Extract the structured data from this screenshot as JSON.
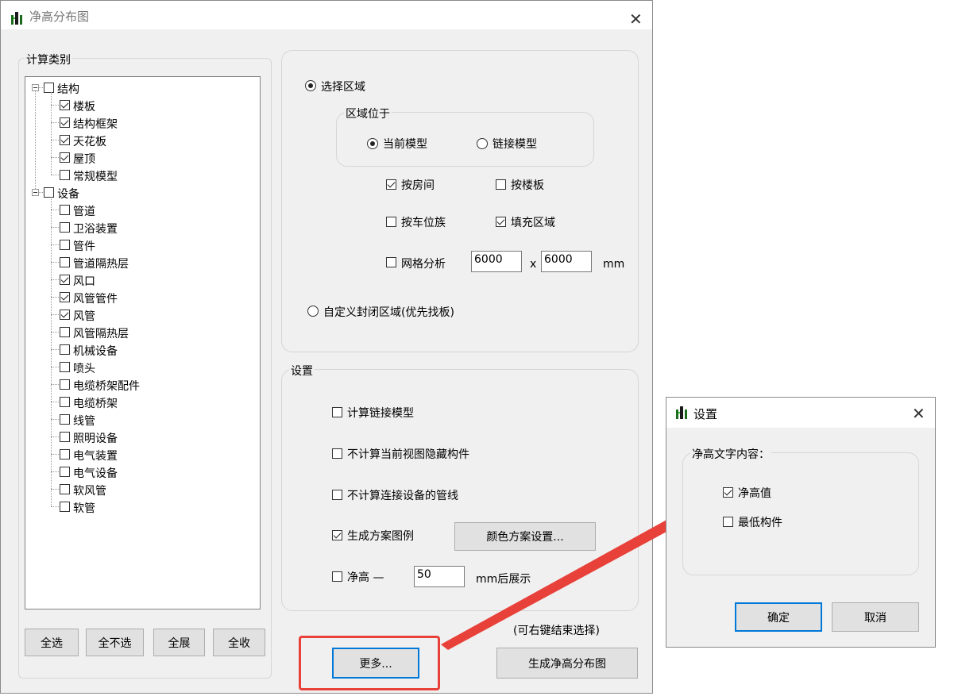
{
  "main_window": {
    "title": "净高分布图",
    "category_group": {
      "label": "计算类别",
      "tree": [
        {
          "label": "结构",
          "level": 0,
          "checked": false,
          "expandable": true
        },
        {
          "label": "楼板",
          "level": 1,
          "checked": true
        },
        {
          "label": "结构框架",
          "level": 1,
          "checked": true
        },
        {
          "label": "天花板",
          "level": 1,
          "checked": true
        },
        {
          "label": "屋顶",
          "level": 1,
          "checked": true
        },
        {
          "label": "常规模型",
          "level": 1,
          "checked": false
        },
        {
          "label": "设备",
          "level": 0,
          "checked": false,
          "expandable": true
        },
        {
          "label": "管道",
          "level": 1,
          "checked": false
        },
        {
          "label": "卫浴装置",
          "level": 1,
          "checked": false
        },
        {
          "label": "管件",
          "level": 1,
          "checked": false
        },
        {
          "label": "管道隔热层",
          "level": 1,
          "checked": false
        },
        {
          "label": "风口",
          "level": 1,
          "checked": true
        },
        {
          "label": "风管管件",
          "level": 1,
          "checked": true
        },
        {
          "label": "风管",
          "level": 1,
          "checked": true
        },
        {
          "label": "风管隔热层",
          "level": 1,
          "checked": false
        },
        {
          "label": "机械设备",
          "level": 1,
          "checked": false
        },
        {
          "label": "喷头",
          "level": 1,
          "checked": false
        },
        {
          "label": "电缆桥架配件",
          "level": 1,
          "checked": false
        },
        {
          "label": "电缆桥架",
          "level": 1,
          "checked": false
        },
        {
          "label": "线管",
          "level": 1,
          "checked": false
        },
        {
          "label": "照明设备",
          "level": 1,
          "checked": false
        },
        {
          "label": "电气装置",
          "level": 1,
          "checked": false
        },
        {
          "label": "电气设备",
          "level": 1,
          "checked": false
        },
        {
          "label": "软风管",
          "level": 1,
          "checked": false
        },
        {
          "label": "软管",
          "level": 1,
          "checked": false
        }
      ],
      "buttons": {
        "select_all": "全选",
        "select_none": "全不选",
        "expand_all": "全展",
        "collapse_all": "全收"
      }
    },
    "region": {
      "select_region_label": "选择区域",
      "select_region_selected": true,
      "location_group_label": "区域位于",
      "current_model_label": "当前模型",
      "current_model_selected": true,
      "linked_model_label": "链接模型",
      "linked_model_selected": false,
      "by_room_label": "按房间",
      "by_room_checked": true,
      "by_floor_label": "按楼板",
      "by_floor_checked": false,
      "by_parking_label": "按车位族",
      "by_parking_checked": false,
      "fill_region_label": "填充区域",
      "fill_region_checked": true,
      "grid_label": "网格分析",
      "grid_checked": false,
      "grid_x": "6000",
      "grid_sep": "x",
      "grid_y": "6000",
      "grid_unit": "mm",
      "custom_region_label": "自定义封闭区域(优先找板)",
      "custom_region_selected": false
    },
    "settings": {
      "label": "设置",
      "calc_linked_label": "计算链接模型",
      "calc_linked_checked": false,
      "skip_hidden_label": "不计算当前视图隐藏构件",
      "skip_hidden_checked": false,
      "skip_connected_label": "不计算连接设备的管线",
      "skip_connected_checked": false,
      "legend_label": "生成方案图例",
      "legend_checked": true,
      "color_scheme_button": "颜色方案设置...",
      "clear_height_label": "净高 —",
      "clear_height_checked": false,
      "clear_height_value": "50",
      "clear_height_suffix": "mm后展示"
    },
    "hint": "(可右键结束选择)",
    "more_button": "更多...",
    "generate_button": "生成净高分布图"
  },
  "settings_dialog": {
    "title": "设置",
    "group_label": "净高文字内容：",
    "clear_height_value_label": "净高值",
    "clear_height_value_checked": true,
    "lowest_component_label": "最低构件",
    "lowest_component_checked": false,
    "ok_button": "确定",
    "cancel_button": "取消"
  },
  "colors": {
    "annotation_red": "#e8413a",
    "window_bg": "#f0f0f0",
    "accent_blue": "#0078d7"
  }
}
